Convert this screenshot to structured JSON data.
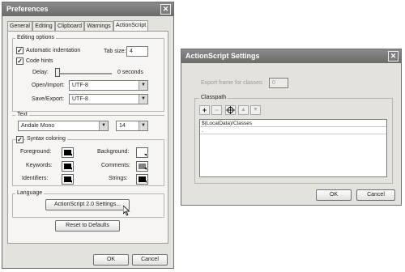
{
  "preferences": {
    "title": "Preferences",
    "tabs": [
      "General",
      "Editing",
      "Clipboard",
      "Warnings",
      "ActionScript"
    ],
    "active_tab": "ActionScript",
    "editing_options": {
      "label": "Editing options",
      "auto_indent_label": "Automatic indentation",
      "auto_indent_checked": true,
      "tab_size_label": "Tab size:",
      "tab_size_value": "4",
      "code_hints_label": "Code hints",
      "code_hints_checked": true,
      "delay_label": "Delay:",
      "delay_value_text": "0 seconds",
      "delay_level": 0,
      "open_import_label": "Open/Import:",
      "open_import_value": "UTF-8",
      "save_export_label": "Save/Export:",
      "save_export_value": "UTF-8"
    },
    "text": {
      "label": "Text",
      "font_value": "Andale Mono",
      "size_value": "14"
    },
    "syntax": {
      "label": "Syntax coloring",
      "checked": true,
      "foreground_label": "Foreground:",
      "background_label": "Background:",
      "keywords_label": "Keywords:",
      "comments_label": "Comments:",
      "identifiers_label": "Identifiers:",
      "strings_label": "Strings:",
      "colors": {
        "foreground": "#000000",
        "background": "#ffffff",
        "keywords": "#000000",
        "comments": "#808080",
        "identifiers": "#000000",
        "strings": "#000000"
      }
    },
    "language": {
      "label": "Language",
      "settings_button": "ActionScript 2.0 Settings..."
    },
    "reset_button": "Reset to Defaults",
    "ok_button": "OK",
    "cancel_button": "Cancel"
  },
  "as_settings": {
    "title": "ActionScript Settings",
    "export_frame_label": "Export frame for classes:",
    "export_frame_value": "0",
    "classpath_label": "Classpath",
    "toolbar_icons": [
      "add-icon",
      "remove-icon",
      "target-icon",
      "move-up-icon",
      "move-down-icon"
    ],
    "classpath_items": [
      "$(LocalData)/Classes",
      "."
    ],
    "ok_button": "OK",
    "cancel_button": "Cancel"
  }
}
